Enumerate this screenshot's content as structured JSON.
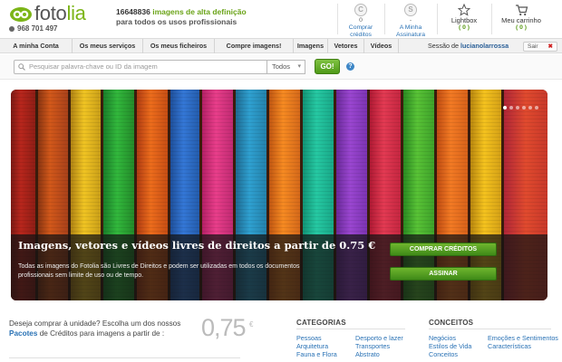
{
  "header": {
    "logo_text_a": "foto",
    "logo_text_b": "lia",
    "phone": "968 701 497",
    "image_count": "16648836",
    "claim_line1_rest": "imagens de alta definição",
    "claim_line2": "para todos os usos profissionais",
    "credits": {
      "icon": "C",
      "value": "0",
      "link": "Comprar créditos"
    },
    "subscription": {
      "icon": "S",
      "value": "-",
      "link": "A Minha Assinatura"
    },
    "lightbox": {
      "label": "Lightbox",
      "count": "( 0 )"
    },
    "cart": {
      "label": "Meu carrinho",
      "count": "( 0 )"
    }
  },
  "nav": {
    "tabs": [
      "A minha Conta",
      "Os meus serviços",
      "Os meus ficheiros",
      "Compre imagens!",
      "Imagens",
      "Vetores",
      "Vídeos"
    ],
    "session_prefix": "Sessão de",
    "username": "lucianolarrossa",
    "logout": "Sair"
  },
  "search": {
    "placeholder": "Pesquisar palavra-chave ou ID da imagem",
    "scope": "Todos",
    "go": "GO!",
    "help": "?"
  },
  "hero": {
    "title": "Imagens, vetores e vídeos livres de direitos a partir de 0.75 €",
    "description": "Todas as imagens do Fotolia são Livres de Direitos e podem ser utilizadas em todos os documentos profissionais sem limite de uso ou de tempo.",
    "buy_button": "COMPRAR CRÉDITOS",
    "subscribe_button": "ASSINAR",
    "slides": 6,
    "active_slide": 1
  },
  "promo": {
    "line1": "Deseja comprar à unidade? Escolha um dos nossos",
    "link": "Pacotes",
    "line2_rest": "de Créditos para imagens a partir de :",
    "price": "0,75",
    "currency": "€"
  },
  "categories": {
    "heading": "CATEGORIAS",
    "col1": [
      "Pessoas",
      "Arquitetura",
      "Fauna e Flora"
    ],
    "col2": [
      "Desporto e lazer",
      "Transportes",
      "Abstrato"
    ]
  },
  "concepts": {
    "heading": "CONCEITOS",
    "col1": [
      "Negócios",
      "Estilos de Vida",
      "Conceitos"
    ],
    "col2": [
      "Emoções e Sentimentos",
      "Características"
    ]
  },
  "colors": {
    "brand_green": "#7cb518",
    "link_blue": "#2a72b5"
  }
}
